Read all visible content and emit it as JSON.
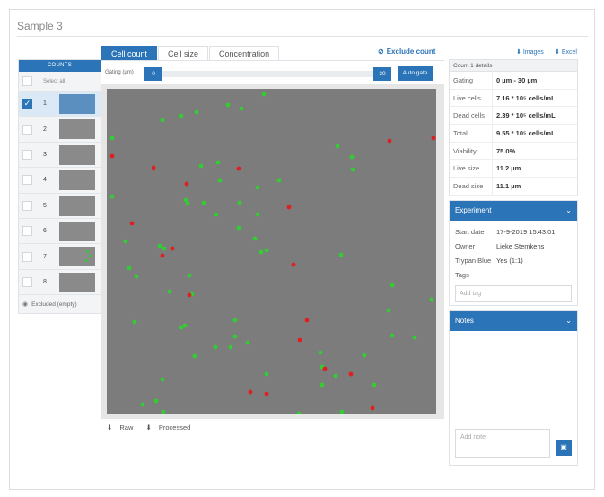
{
  "page": {
    "title": "Sample 3"
  },
  "counts": {
    "header": "COUNTS",
    "select_all": "Select all",
    "items": [
      {
        "label": "1",
        "checked": true
      },
      {
        "label": "2",
        "checked": false
      },
      {
        "label": "3",
        "checked": false
      },
      {
        "label": "4",
        "checked": false
      },
      {
        "label": "5",
        "checked": false
      },
      {
        "label": "6",
        "checked": false
      },
      {
        "label": "7",
        "checked": false
      },
      {
        "label": "8",
        "checked": false
      }
    ],
    "excluded_label": "Excluded (empty)"
  },
  "tabs": [
    {
      "label": "Cell count",
      "active": true
    },
    {
      "label": "Cell size",
      "active": false
    },
    {
      "label": "Concentration",
      "active": false
    }
  ],
  "toolbar": {
    "exclude_count": "Exclude count",
    "images_link": "Images",
    "excel_link": "Excel"
  },
  "gating": {
    "label": "Gating (µm)",
    "min_value": "0",
    "max_value": "30",
    "auto_gate": "Auto gate"
  },
  "downloads": {
    "raw": "Raw",
    "processed": "Processed"
  },
  "details": {
    "header": "Count 1 details",
    "rows": [
      {
        "key": "Gating",
        "value": "0 µm - 30 µm"
      },
      {
        "key": "Live cells",
        "value": "7.16 * 10⁵ cells/mL"
      },
      {
        "key": "Dead cells",
        "value": "2.39 * 10⁵ cells/mL"
      },
      {
        "key": "Total",
        "value": "9.55 * 10⁵ cells/mL"
      },
      {
        "key": "Viability",
        "value": "75.0%"
      },
      {
        "key": "Live size",
        "value": "11.2 µm"
      },
      {
        "key": "Dead size",
        "value": "11.1 µm"
      }
    ]
  },
  "experiment": {
    "header": "Experiment",
    "start_date_key": "Start date",
    "start_date": "17-9-2019 15:43:01",
    "owner_key": "Owner",
    "owner": "Lieke Stemkens",
    "trypan_key": "Trypan Blue",
    "trypan": "Yes (1:1)",
    "tags_key": "Tags",
    "tag_placeholder": "Add tag"
  },
  "notes": {
    "header": "Notes",
    "placeholder": "Add note"
  },
  "colors": {
    "accent": "#2c74b8",
    "live_cell": "#33cc33",
    "dead_cell": "#e02020",
    "image_bg": "#7c7c7c"
  }
}
